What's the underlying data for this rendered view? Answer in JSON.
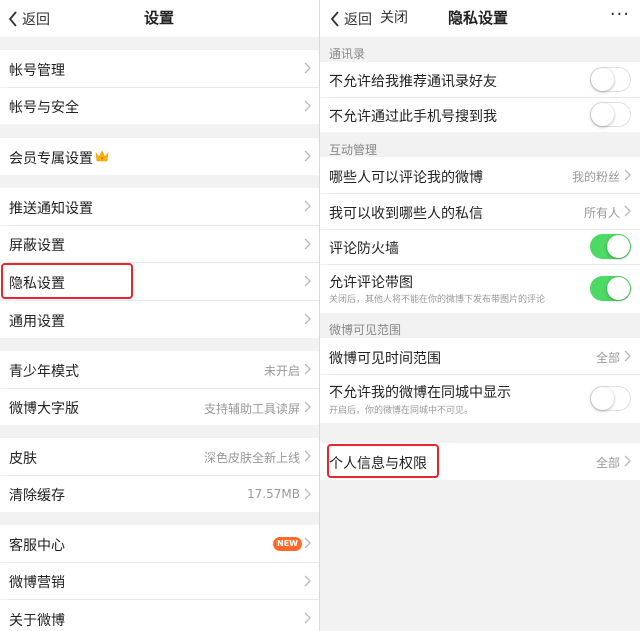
{
  "colors": {
    "accent_red": "#e8262d",
    "toggle_on": "#4cd964",
    "badge": "#ff6a2b"
  },
  "left": {
    "nav": {
      "back_label": "返回",
      "title": "设置"
    },
    "items": [
      {
        "label": "帐号管理"
      },
      {
        "label": "帐号与安全"
      },
      {
        "label": "会员专属设置",
        "icon": "crown-icon"
      },
      {
        "label": "推送通知设置"
      },
      {
        "label": "屏蔽设置"
      },
      {
        "label": "隐私设置"
      },
      {
        "label": "通用设置"
      },
      {
        "label": "青少年模式",
        "value": "未开启"
      },
      {
        "label": "微博大字版",
        "value": "支持辅助工具读屏"
      },
      {
        "label": "皮肤",
        "value": "深色皮肤全新上线"
      },
      {
        "label": "清除缓存",
        "value": "17.57MB"
      },
      {
        "label": "客服中心",
        "badge": "NEW"
      },
      {
        "label": "微博营销"
      },
      {
        "label": "关于微博"
      }
    ]
  },
  "right": {
    "nav": {
      "back_label": "返回",
      "close_label": "关闭",
      "title": "隐私设置",
      "more": "···"
    },
    "sections": [
      {
        "header": "通讯录"
      },
      {
        "header": "互动管理"
      },
      {
        "header": "微博可见范围"
      }
    ],
    "items": [
      {
        "label": "不允许给我推荐通讯录好友",
        "toggle": false
      },
      {
        "label": "不允许通过此手机号搜到我",
        "toggle": false
      },
      {
        "label": "哪些人可以评论我的微博",
        "value": "我的粉丝"
      },
      {
        "label": "我可以收到哪些人的私信",
        "value": "所有人"
      },
      {
        "label": "评论防火墙",
        "toggle": true
      },
      {
        "label": "允许评论带图",
        "toggle": true,
        "subtext": "关闭后，其他人将不能在你的微博下发布带图片的评论"
      },
      {
        "label": "微博可见时间范围",
        "value": "全部"
      },
      {
        "label": "不允许我的微博在同城中显示",
        "toggle": false,
        "subtext": "开启后，你的微博在同城中不可见。"
      },
      {
        "label": "个人信息与权限",
        "value": "全部"
      }
    ]
  }
}
